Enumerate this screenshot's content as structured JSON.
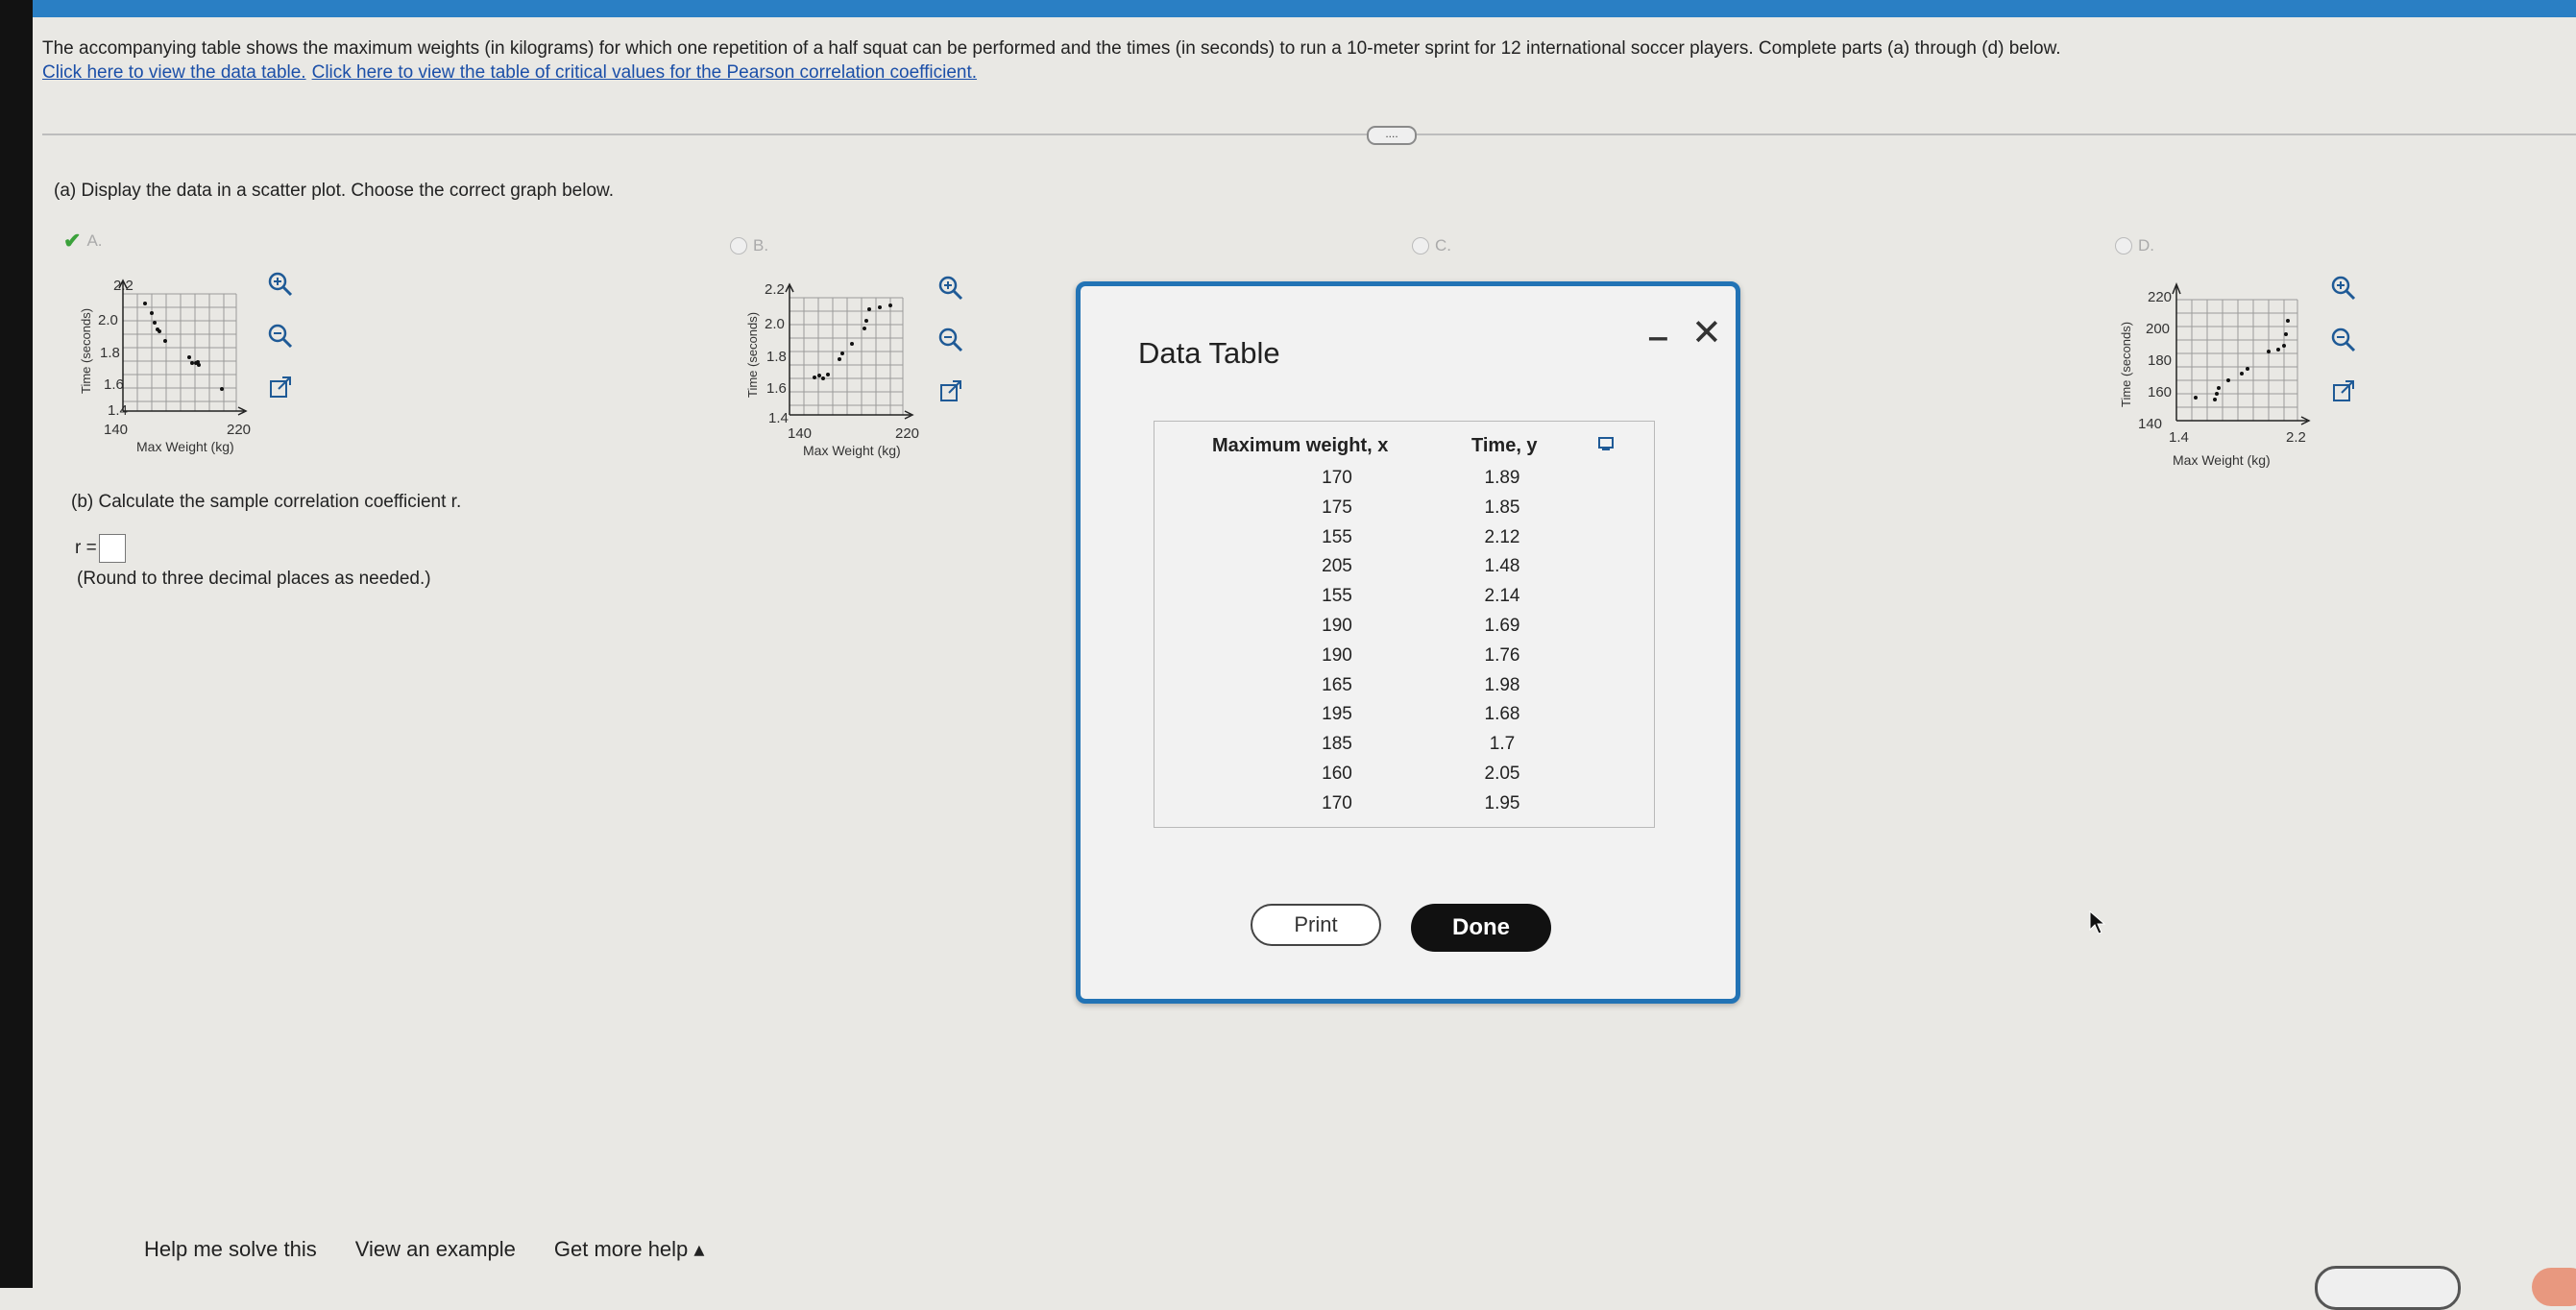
{
  "question": {
    "text": "The accompanying table shows the maximum weights (in kilograms) for which one repetition of a half squat can be performed and the times (in seconds) to run a 10-meter sprint for 12 international soccer players. Complete parts (a) through (d) below.",
    "link_data_table": "Click here to view the data table.",
    "link_critical_values": "Click here to view the table of critical values for the Pearson correlation coefficient.",
    "more_button": "...."
  },
  "part_a": {
    "prompt": "(a) Display the data in a scatter plot. Choose the correct graph below.",
    "selected": "A",
    "choices": [
      {
        "letter": "A.",
        "xlabel": "Max Weight (kg)",
        "ylabel": "Time (seconds)",
        "x_ticks": [
          "140",
          "220"
        ],
        "y_ticks": [
          "2.2",
          "2.0",
          "1.8",
          "1.6",
          "1.4"
        ]
      },
      {
        "letter": "B.",
        "xlabel": "Max Weight (kg)",
        "ylabel": "Time (seconds)",
        "x_ticks": [
          "140",
          "220"
        ],
        "y_ticks": [
          "2.2",
          "2.0",
          "1.8",
          "1.6",
          "1.4"
        ]
      },
      {
        "letter": "C."
      },
      {
        "letter": "D.",
        "xlabel": "Max Weight (kg)",
        "ylabel": "Time (seconds)",
        "x_ticks": [
          "1.4",
          "2.2"
        ],
        "y_ticks": [
          "220",
          "200",
          "180",
          "160",
          "140"
        ]
      }
    ]
  },
  "part_b": {
    "prompt": "(b) Calculate the sample correlation coefficient r.",
    "r_label": "r =",
    "r_value": "",
    "note": "(Round to three decimal places as needed.)"
  },
  "modal": {
    "title": "Data Table",
    "col_x": "Maximum weight, x",
    "col_y": "Time, y",
    "rows": [
      {
        "x": "170",
        "y": "1.89"
      },
      {
        "x": "175",
        "y": "1.85"
      },
      {
        "x": "155",
        "y": "2.12"
      },
      {
        "x": "205",
        "y": "1.48"
      },
      {
        "x": "155",
        "y": "2.14"
      },
      {
        "x": "190",
        "y": "1.69"
      },
      {
        "x": "190",
        "y": "1.76"
      },
      {
        "x": "165",
        "y": "1.98"
      },
      {
        "x": "195",
        "y": "1.68"
      },
      {
        "x": "185",
        "y": "1.7"
      },
      {
        "x": "160",
        "y": "2.05"
      },
      {
        "x": "170",
        "y": "1.95"
      }
    ],
    "print_label": "Print",
    "done_label": "Done",
    "minimize_glyph": "‒",
    "close_glyph": "✕"
  },
  "footer": {
    "help_solve": "Help me solve this",
    "view_example": "View an example",
    "get_more_help": "Get more help ▴"
  },
  "colors": {
    "accent": "#2273b5",
    "link": "#1b4fa8",
    "check": "#3aa13a"
  }
}
